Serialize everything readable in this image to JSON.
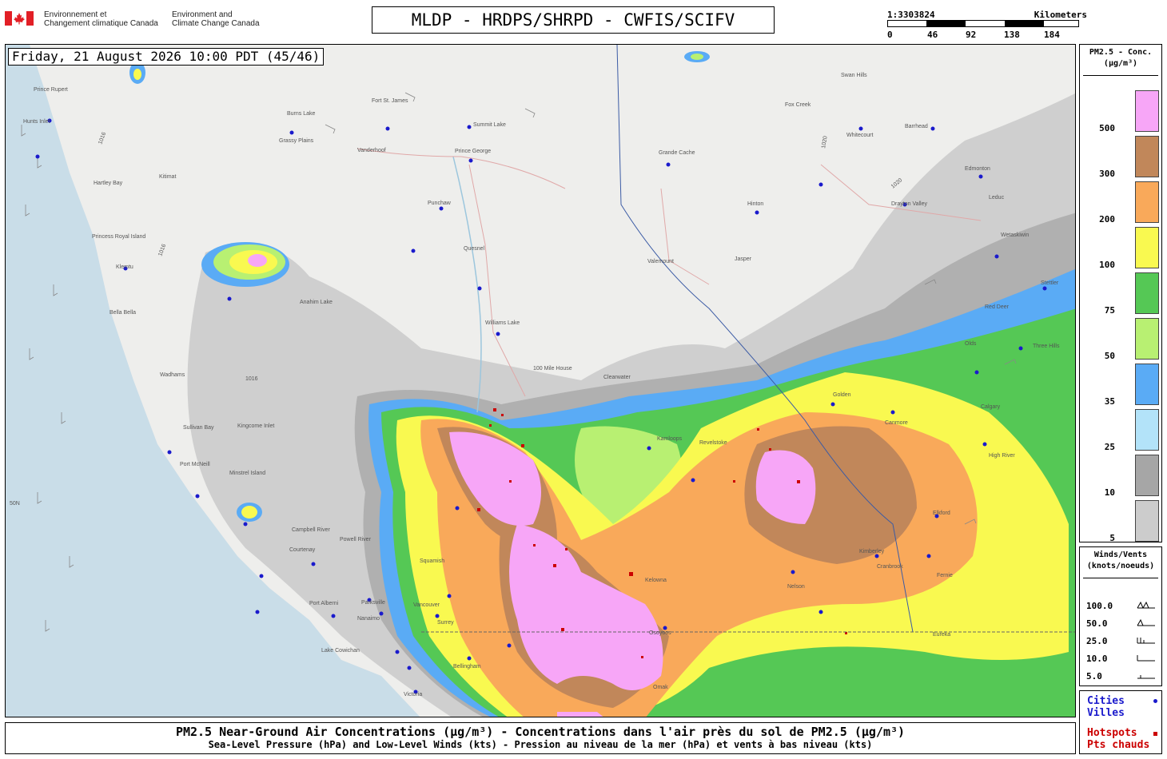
{
  "header": {
    "agency_fr": "Environnement et\nChangement climatique Canada",
    "agency_en": "Environment and\nClimate Change Canada",
    "title": "MLDP - HRDPS/SHRPD - CWFIS/SCIFV"
  },
  "scale": {
    "ratio": "1:3303824",
    "unit": "Kilometers",
    "ticks": [
      "0",
      "46",
      "92",
      "138",
      "184"
    ]
  },
  "map": {
    "timestamp": "Friday, 21 August 2026 10:00 PDT (45/46)",
    "isobar_label": "1016",
    "isobar_label_2": "1020",
    "latitude_label": "50N",
    "cities": [
      "Prince Rupert",
      "Hunts Inlet",
      "Burns Lake",
      "Fort St. James",
      "Grassy Plains",
      "Summit Lake",
      "Vanderhoof",
      "Prince George",
      "Grande Cache",
      "Swan Hills",
      "Fox Creek",
      "Whitecourt",
      "Barrhead",
      "Edmonton",
      "Leduc",
      "Drayton Valley",
      "Wetaskiwin",
      "Stettler",
      "Three Hills",
      "Olds",
      "Calgary",
      "High River",
      "Red Deer",
      "Kitimat",
      "Hartley Bay",
      "Punchaw",
      "Quesnel",
      "Hinton",
      "Valemount",
      "Jasper",
      "Princess Royal Island",
      "Klemtu",
      "Bella Bella",
      "Anahim Lake",
      "Williams Lake",
      "Wadhams",
      "100 Mile House",
      "Clearwater",
      "Kamloops",
      "Sullivan Bay",
      "Kingcome Inlet",
      "Port McNeill",
      "Minstrel Island",
      "Campbell River",
      "Powell River",
      "Courtenay",
      "Squamish",
      "Port Alberni",
      "Parksville",
      "Nanaimo",
      "Vancouver",
      "Surrey",
      "Lake Cowichan",
      "Bellingham",
      "Victoria",
      "Kelowna",
      "Osoyoos",
      "Omak",
      "Nelson",
      "Cranbrook",
      "Fernie",
      "Elkford",
      "Kimberley",
      "Eureka",
      "Canmore",
      "Golden",
      "Revelstoke"
    ]
  },
  "legend_pm": {
    "title": "PM2.5 - Conc.\n(µg/m³)",
    "levels": [
      {
        "label": "500",
        "color": "#f7a6f7"
      },
      {
        "label": "300",
        "color": "#c1875a"
      },
      {
        "label": "200",
        "color": "#f9a95a"
      },
      {
        "label": "100",
        "color": "#f9f950"
      },
      {
        "label": "75",
        "color": "#55c855"
      },
      {
        "label": "50",
        "color": "#b8f072"
      },
      {
        "label": "35",
        "color": "#5aabf5"
      },
      {
        "label": "25",
        "color": "#b3e3f9"
      },
      {
        "label": "10",
        "color": "#a6a6a6"
      },
      {
        "label": "5",
        "color": "#cccccc"
      }
    ]
  },
  "legend_wind": {
    "title": "Winds/Vents\n(knots/noeuds)",
    "rows": [
      "100.0",
      "50.0",
      "25.0",
      "10.0",
      "5.0"
    ]
  },
  "legend_points": {
    "cities": "Cities\nVilles",
    "hotspots": "Hotspots\nPts chauds"
  },
  "footer": {
    "line1": "PM2.5 Near-Ground Air Concentrations (µg/m³) - Concentrations dans l'air près du sol de PM2.5 (µg/m³)",
    "line2": "Sea-Level Pressure (hPa) and Low-Level Winds (kts) - Pression au niveau de la mer (hPa) et vents à bas niveau (kts)"
  },
  "colors": {
    "city_dot": "#1a1acc",
    "hotspot": "#cc0000",
    "land": "#eeeeec",
    "water": "#bcd8e6"
  }
}
